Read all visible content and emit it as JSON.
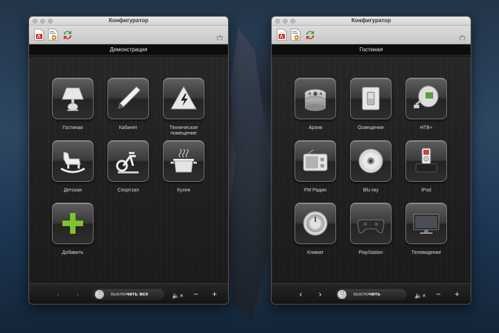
{
  "windows": [
    {
      "title": "Конфигуратор",
      "section": "Демонстрация",
      "tiles": [
        {
          "label": "Гостиная",
          "icon": "lamp-icon"
        },
        {
          "label": "Кабинет",
          "icon": "pen-icon"
        },
        {
          "label": "Техническое помещение",
          "icon": "high-voltage-icon"
        },
        {
          "label": "Детская",
          "icon": "rocking-horse-icon"
        },
        {
          "label": "Спортзал",
          "icon": "exercise-bike-icon"
        },
        {
          "label": "Кухня",
          "icon": "cooking-pot-icon"
        },
        {
          "label": "Добавить",
          "icon": "plus-icon"
        }
      ],
      "power": {
        "prefix": "выклю",
        "rest": "чить все"
      }
    },
    {
      "title": "Конфигуратор",
      "section": "Гостиная",
      "tiles": [
        {
          "label": "Архив",
          "icon": "film-reel-icon"
        },
        {
          "label": "Освещение",
          "icon": "light-switch-icon"
        },
        {
          "label": "НТВ+",
          "icon": "satellite-dish-icon"
        },
        {
          "label": "FM Радио",
          "icon": "radio-icon"
        },
        {
          "label": "Blu-ray",
          "icon": "disc-icon"
        },
        {
          "label": "iPod",
          "icon": "ipod-dock-icon"
        },
        {
          "label": "Климат",
          "icon": "dial-icon"
        },
        {
          "label": "PlayStation",
          "icon": "gamepad-icon"
        },
        {
          "label": "Телевидение",
          "icon": "tv-icon"
        }
      ],
      "power": {
        "prefix": "выклю",
        "rest": "чить"
      }
    }
  ],
  "controls": {
    "prev": "‹",
    "next": "›",
    "mute": "🔈×",
    "minus": "−",
    "plus": "+"
  },
  "colors": {
    "plus_green": "#7ec230",
    "window_bg": "#1a1a1a",
    "titlebar": "#dcdcdc"
  }
}
